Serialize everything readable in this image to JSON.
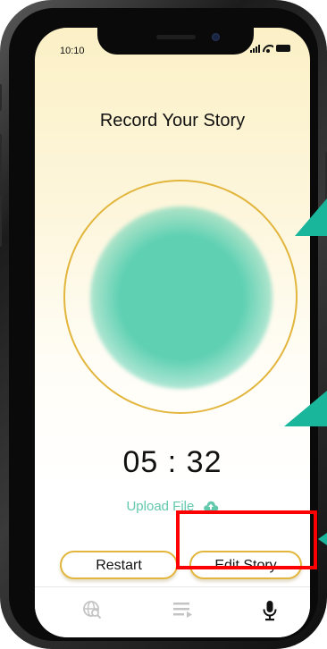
{
  "status_bar": {
    "time": "10:10"
  },
  "page": {
    "title": "Record Your Story"
  },
  "recorder": {
    "timer": "05 : 32",
    "upload_label": "Upload File"
  },
  "actions": {
    "restart_label": "Restart",
    "edit_label": "Edit Story"
  },
  "tab_bar": {
    "tabs": [
      {
        "icon": "globe-search-icon",
        "active": false
      },
      {
        "icon": "playlist-icon",
        "active": false
      },
      {
        "icon": "microphone-icon",
        "active": true
      }
    ]
  },
  "colors": {
    "accent_teal": "#5fd0b2",
    "ring_gold": "#e2b63d",
    "highlight_red": "#ff0000",
    "arrow_teal": "#1ab69c"
  }
}
